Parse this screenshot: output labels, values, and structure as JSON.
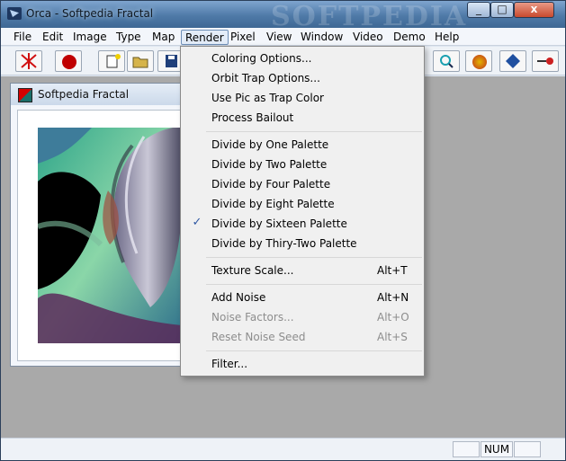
{
  "window": {
    "title": "Orca - Softpedia Fractal",
    "watermark": "SOFTPEDIA",
    "controls": {
      "minimize": "_",
      "maximize": "□",
      "close": "x"
    }
  },
  "menubar": {
    "items": [
      {
        "label": "File"
      },
      {
        "label": "Edit"
      },
      {
        "label": "Image"
      },
      {
        "label": "Type"
      },
      {
        "label": "Map"
      },
      {
        "label": "Render"
      },
      {
        "label": "Pixel"
      },
      {
        "label": "View"
      },
      {
        "label": "Window"
      },
      {
        "label": "Video"
      },
      {
        "label": "Demo"
      },
      {
        "label": "Help"
      }
    ]
  },
  "toolbar": {
    "icons": [
      {
        "name": "red-splat-icon",
        "color": "#d01010"
      },
      {
        "name": "red-mask-icon",
        "color": "#c00000"
      },
      {
        "name": "new-file-icon",
        "color": "#f0d000"
      },
      {
        "name": "open-folder-icon",
        "color": "#d6b44a"
      },
      {
        "name": "save-icon",
        "color": "#1f3f7a"
      },
      {
        "name": "zoom-icon",
        "color": "#1aa0b0"
      },
      {
        "name": "palette-icon",
        "color": "#e3b400"
      },
      {
        "name": "diamond-icon",
        "color": "#2050a0"
      },
      {
        "name": "pointer-icon",
        "color": "#cc2020"
      }
    ]
  },
  "child_window": {
    "title": "Softpedia Fractal"
  },
  "render_menu": {
    "items": [
      {
        "label": "Coloring Options...",
        "shortcut": "",
        "checked": false,
        "disabled": false
      },
      {
        "label": "Orbit Trap Options...",
        "shortcut": "",
        "checked": false,
        "disabled": false
      },
      {
        "label": "Use Pic as Trap Color",
        "shortcut": "",
        "checked": false,
        "disabled": false
      },
      {
        "label": "Process Bailout",
        "shortcut": "",
        "checked": false,
        "disabled": false
      },
      {
        "label": "Divide by One Palette",
        "shortcut": "",
        "checked": false,
        "disabled": false
      },
      {
        "label": "Divide by Two Palette",
        "shortcut": "",
        "checked": false,
        "disabled": false
      },
      {
        "label": "Divide by Four Palette",
        "shortcut": "",
        "checked": false,
        "disabled": false
      },
      {
        "label": "Divide by Eight Palette",
        "shortcut": "",
        "checked": false,
        "disabled": false
      },
      {
        "label": "Divide by Sixteen Palette",
        "shortcut": "",
        "checked": true,
        "disabled": false
      },
      {
        "label": "Divide by Thiry-Two Palette",
        "shortcut": "",
        "checked": false,
        "disabled": false
      },
      {
        "label": "Texture Scale...",
        "shortcut": "Alt+T",
        "checked": false,
        "disabled": false
      },
      {
        "label": "Add Noise",
        "shortcut": "Alt+N",
        "checked": false,
        "disabled": false
      },
      {
        "label": "Noise Factors...",
        "shortcut": "Alt+O",
        "checked": false,
        "disabled": true
      },
      {
        "label": "Reset Noise Seed",
        "shortcut": "Alt+S",
        "checked": false,
        "disabled": true
      },
      {
        "label": "Filter...",
        "shortcut": "",
        "checked": false,
        "disabled": false
      }
    ],
    "check_mark": "✓"
  },
  "statusbar": {
    "cells": [
      "",
      "NUM",
      ""
    ]
  }
}
